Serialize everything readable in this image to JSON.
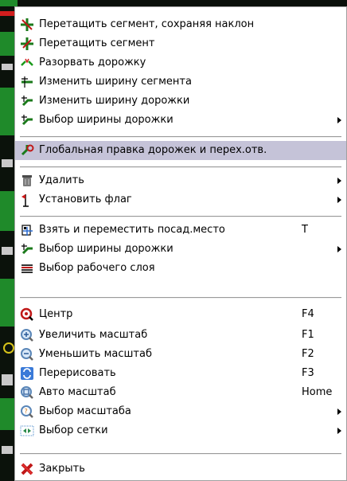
{
  "menu": {
    "items": [
      {
        "label": "Перетащить сегмент, сохраняя наклон",
        "icon": "drag-segment-keep-slope-icon"
      },
      {
        "label": "Перетащить сегмент",
        "icon": "drag-segment-icon"
      },
      {
        "label": "Разорвать дорожку",
        "icon": "break-track-icon"
      },
      {
        "label": "Изменить ширину сегмента",
        "icon": "change-segment-width-icon"
      },
      {
        "label": "Изменить ширину дорожки",
        "icon": "change-track-width-icon"
      },
      {
        "label": "Выбор ширины дорожки",
        "icon": "select-track-width-icon",
        "submenu": true
      },
      {
        "label": "Глобальная правка дорожек и перех.отв.",
        "icon": "global-edit-tracks-vias-icon",
        "highlighted": true
      },
      {
        "label": "Удалить",
        "icon": "delete-icon",
        "submenu": true
      },
      {
        "label": "Установить флаг",
        "icon": "flag-icon",
        "submenu": true
      },
      {
        "label": "Взять и переместить посад.место",
        "icon": "move-footprint-icon",
        "shortcut": "T"
      },
      {
        "label": "Выбор ширины дорожки",
        "icon": "select-track-width-icon",
        "submenu": true
      },
      {
        "label": "Выбор рабочего слоя",
        "icon": "select-layer-icon"
      },
      {
        "label": "Центр",
        "icon": "center-icon",
        "shortcut": "F4"
      },
      {
        "label": "Увеличить масштаб",
        "icon": "zoom-in-icon",
        "shortcut": "F1"
      },
      {
        "label": "Уменьшить масштаб",
        "icon": "zoom-out-icon",
        "shortcut": "F2"
      },
      {
        "label": "Перерисовать",
        "icon": "redraw-icon",
        "shortcut": "F3"
      },
      {
        "label": "Авто масштаб",
        "icon": "zoom-auto-icon",
        "shortcut": "Home"
      },
      {
        "label": "Выбор масштаба",
        "icon": "zoom-select-icon",
        "submenu": true
      },
      {
        "label": "Выбор сетки",
        "icon": "grid-select-icon",
        "submenu": true
      },
      {
        "label": "Закрыть",
        "icon": "close-icon"
      }
    ]
  },
  "colors": {
    "highlight": "#c5c3d8",
    "menu_bg": "#ffffff",
    "pcb_bg": "#0a0f0a",
    "trace_green": "#1f8a2a"
  }
}
